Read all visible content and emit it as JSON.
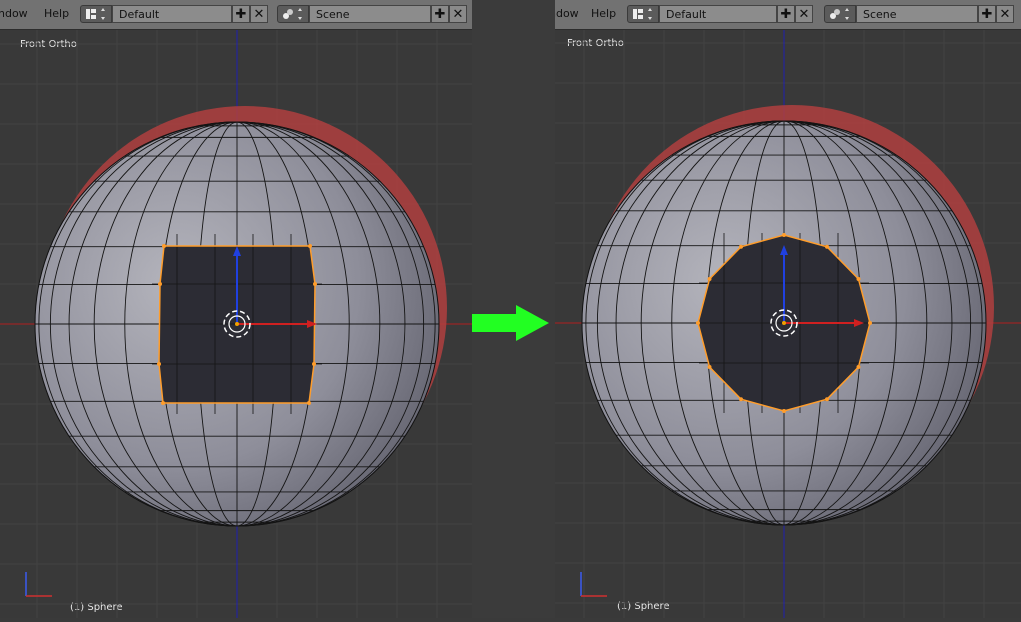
{
  "panels": [
    {
      "menu": {
        "window_partial": "ndow",
        "help": "Help"
      },
      "screen_selector": {
        "value": "Default"
      },
      "scene_selector": {
        "value": "Scene"
      },
      "viewport": {
        "view_label": "Front Ortho",
        "object_label": "(1) Sphere",
        "hole_shape": "square"
      }
    },
    {
      "menu": {
        "window_partial": "ndow",
        "help": "Help"
      },
      "screen_selector": {
        "value": "Default"
      },
      "scene_selector": {
        "value": "Scene"
      },
      "viewport": {
        "view_label": "Front Ortho",
        "object_label": "(1) Sphere",
        "hole_shape": "circle"
      }
    }
  ],
  "arrow": {
    "color": "#22ff22",
    "direction": "right"
  },
  "colors": {
    "selected_edge": "#ff9d2b",
    "sphere_shell": "#b04040",
    "x_axis": "#b02020",
    "y_axis": "#2020b0"
  },
  "buttons": {
    "add_symbol": "✚",
    "close_symbol": "✕"
  }
}
